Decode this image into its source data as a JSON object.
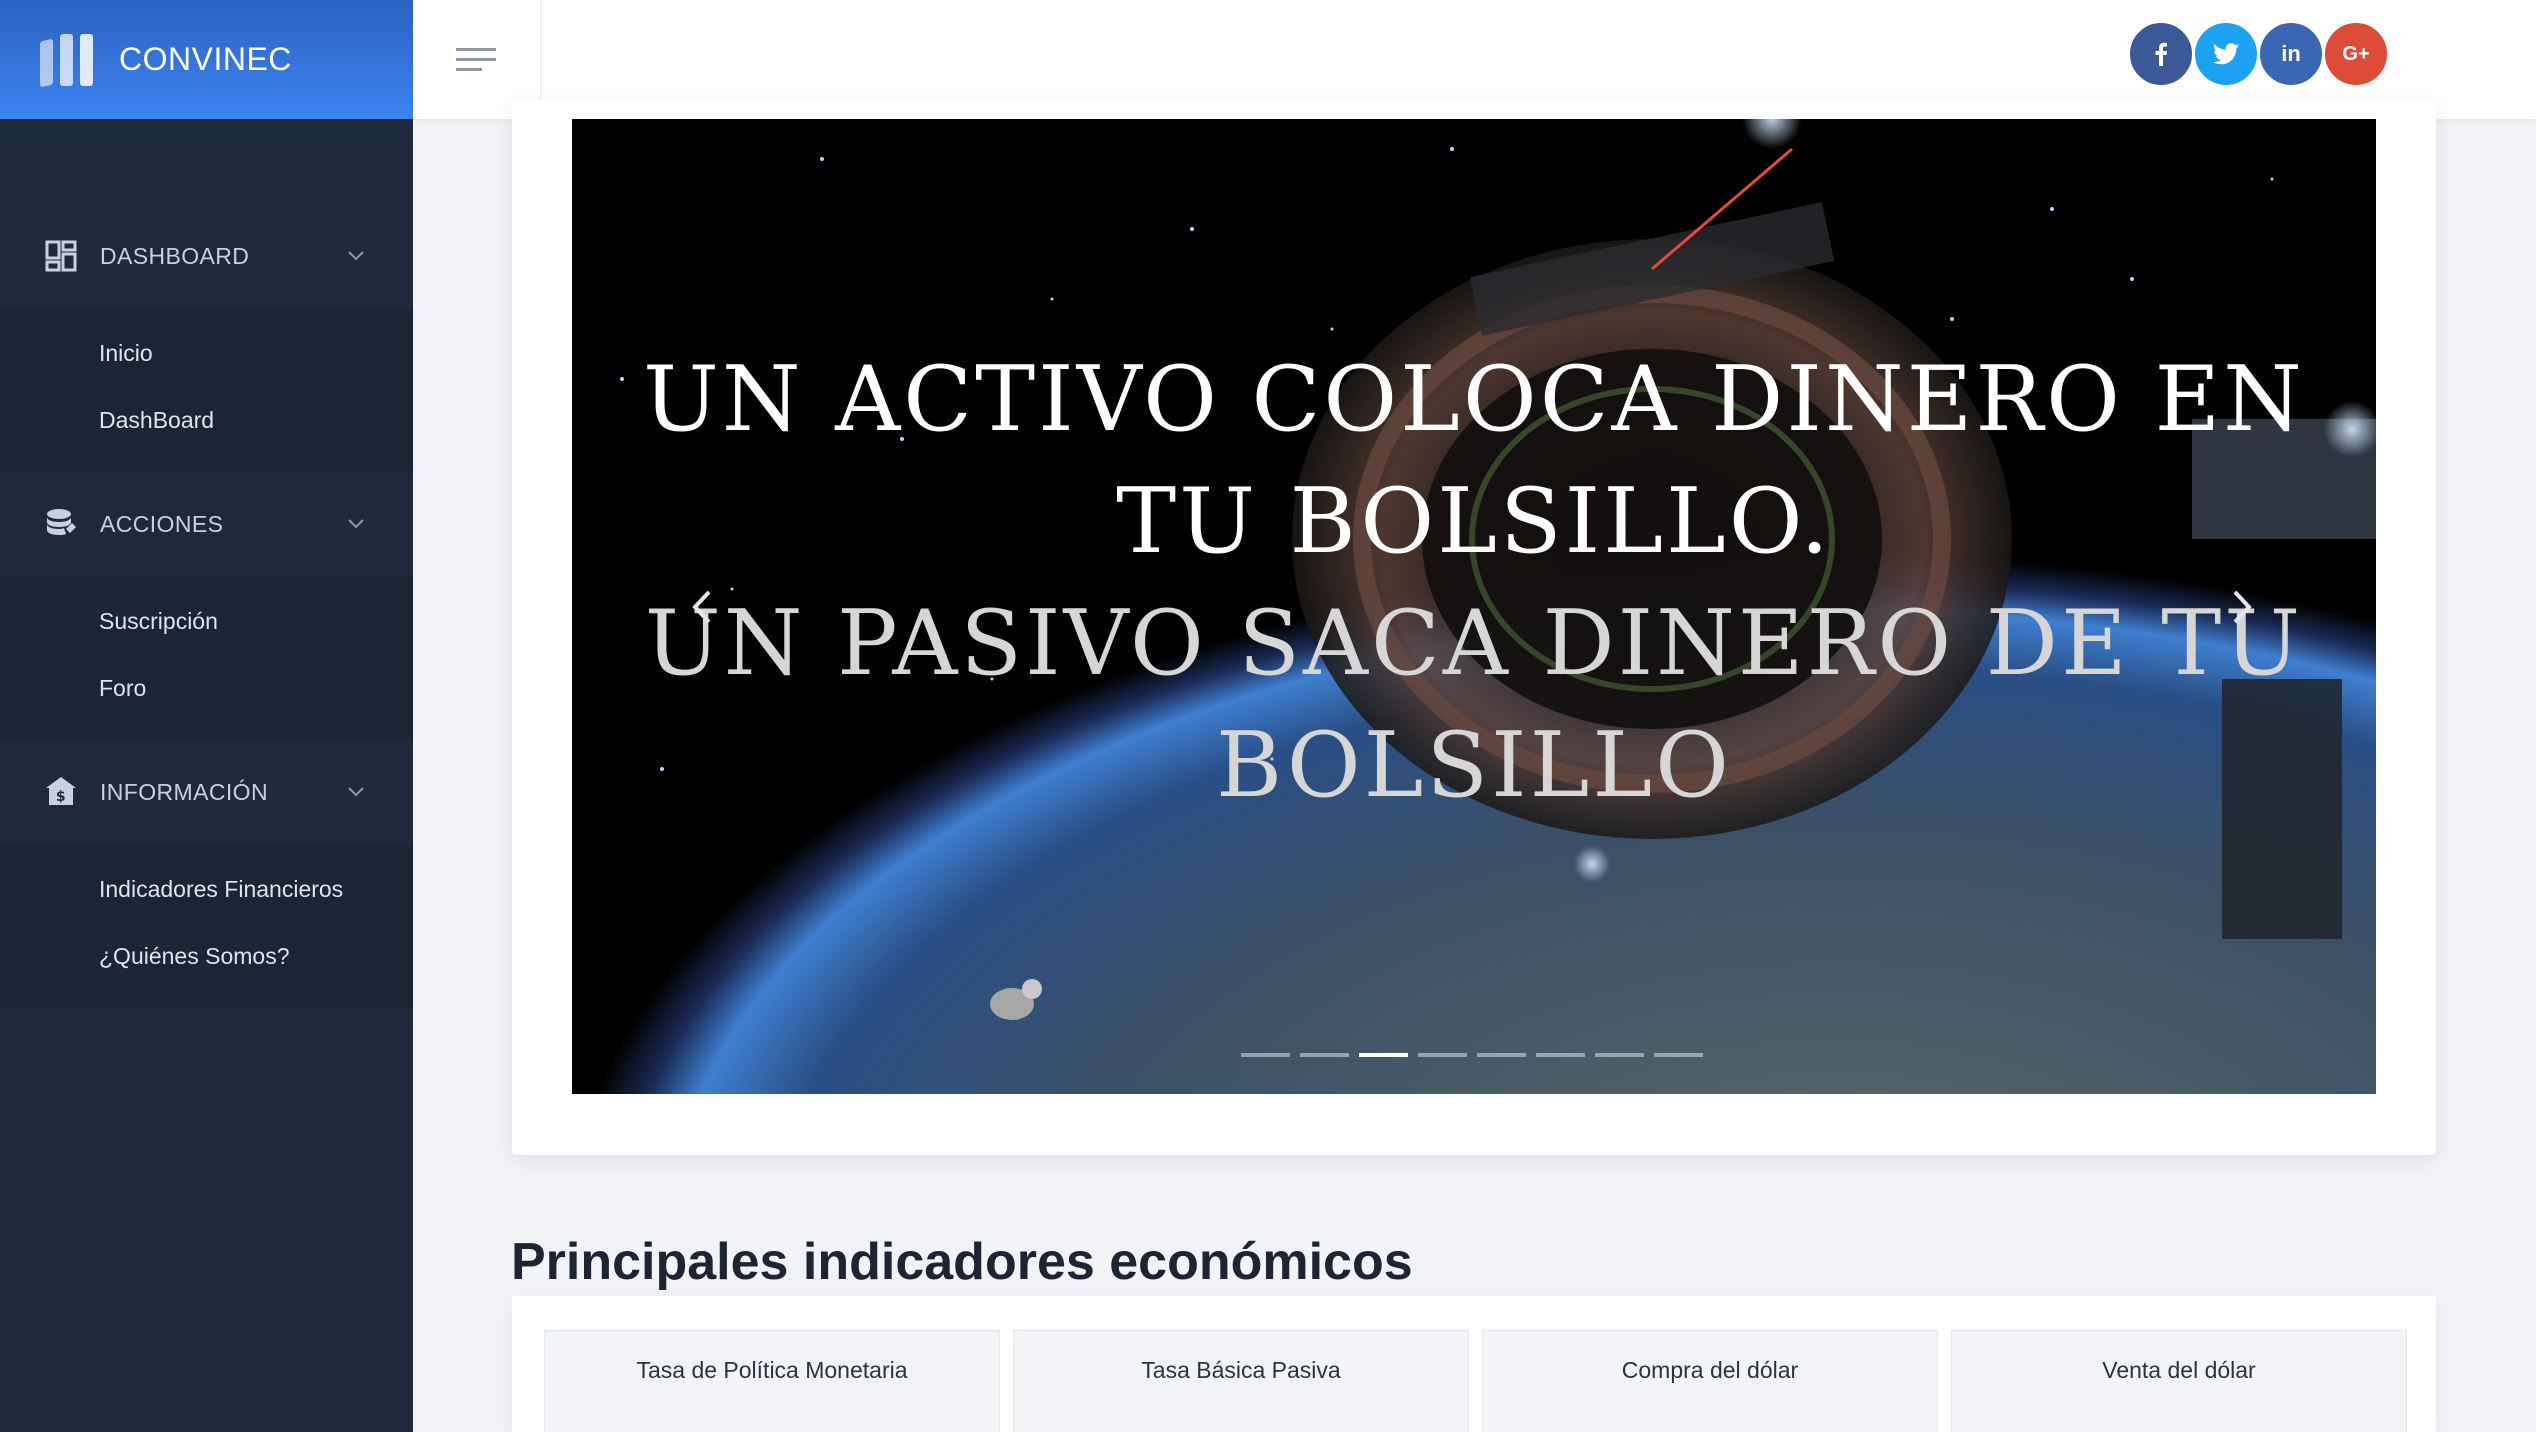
{
  "brand": {
    "name": "CONVINEC"
  },
  "sidebar": {
    "groups": [
      {
        "label": "DASHBOARD",
        "icon": "dashboard-grid-icon",
        "items": [
          "Inicio",
          "DashBoard"
        ]
      },
      {
        "label": "ACCIONES",
        "icon": "coins-icon",
        "items": [
          "Suscripción",
          "Foro"
        ]
      },
      {
        "label": "INFORMACIÓN",
        "icon": "bank-icon",
        "items": [
          "Indicadores Financieros",
          "¿Quiénes Somos?"
        ]
      }
    ]
  },
  "topbar": {
    "menu_icon": "hamburger-icon",
    "social": [
      {
        "name": "facebook",
        "glyph": "f",
        "color": "#3b5998"
      },
      {
        "name": "twitter",
        "glyph": "t",
        "color": "#1da1f2"
      },
      {
        "name": "linkedin",
        "glyph": "in",
        "color": "#3a66b3"
      },
      {
        "name": "google-plus",
        "glyph": "G+",
        "color": "#dd4b39"
      }
    ]
  },
  "carousel": {
    "line1": "Un activo coloca dinero en tu bolsillo.",
    "line2": "Un pasivo saca dinero de tu bolsillo",
    "slide_count": 8,
    "active_index": 2,
    "prev_icon": "chevron-left-icon",
    "next_icon": "chevron-right-icon"
  },
  "indicators": {
    "title": "Principales indicadores económicos",
    "columns": [
      "Tasa de Política Monetaria",
      "Tasa Básica Pasiva",
      "Compra del dólar",
      "Venta del dólar"
    ]
  },
  "colors": {
    "sidebar_bg": "#1e2a3b",
    "brand_gradient_top": "#2a62c0",
    "brand_gradient_bottom": "#3e84f2"
  }
}
